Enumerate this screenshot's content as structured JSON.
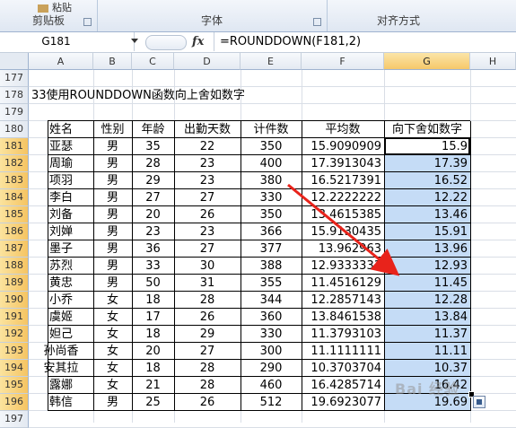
{
  "ribbon": {
    "paste_label": "粘贴",
    "groups": [
      {
        "label": "剪贴板"
      },
      {
        "label": "字体"
      },
      {
        "label": "对齐方式"
      }
    ]
  },
  "formula_bar": {
    "name_box": "G181",
    "fx": "fx",
    "formula": "=ROUNDDOWN(F181,2)"
  },
  "columns": [
    "A",
    "B",
    "C",
    "D",
    "E",
    "F",
    "G",
    "H"
  ],
  "selected_column": "G",
  "title_row": {
    "row": "178",
    "text": "33使用ROUNDDOWN函数向上舍如数字"
  },
  "header_row": {
    "row": "180",
    "cells": [
      "姓名",
      "性别",
      "年龄",
      "出勤天数",
      "计件数",
      "平均数",
      "向下舍如数字"
    ]
  },
  "rows_top": [
    "177",
    "178",
    "179"
  ],
  "data_rows": [
    {
      "row": "181",
      "name": "亚瑟",
      "gender": "男",
      "age": "35",
      "days": "22",
      "pieces": "350",
      "avg": "15.9090909",
      "round": "15.9"
    },
    {
      "row": "182",
      "name": "周瑜",
      "gender": "男",
      "age": "28",
      "days": "23",
      "pieces": "400",
      "avg": "17.3913043",
      "round": "17.39"
    },
    {
      "row": "183",
      "name": "项羽",
      "gender": "男",
      "age": "29",
      "days": "23",
      "pieces": "380",
      "avg": "16.5217391",
      "round": "16.52"
    },
    {
      "row": "184",
      "name": "李白",
      "gender": "男",
      "age": "27",
      "days": "27",
      "pieces": "330",
      "avg": "12.2222222",
      "round": "12.22"
    },
    {
      "row": "185",
      "name": "刘备",
      "gender": "男",
      "age": "20",
      "days": "26",
      "pieces": "350",
      "avg": "13.4615385",
      "round": "13.46"
    },
    {
      "row": "186",
      "name": "刘婵",
      "gender": "男",
      "age": "23",
      "days": "23",
      "pieces": "366",
      "avg": "15.9130435",
      "round": "15.91"
    },
    {
      "row": "187",
      "name": "墨子",
      "gender": "男",
      "age": "36",
      "days": "27",
      "pieces": "377",
      "avg": "13.962963",
      "round": "13.96"
    },
    {
      "row": "188",
      "name": "苏烈",
      "gender": "男",
      "age": "33",
      "days": "30",
      "pieces": "388",
      "avg": "12.9333333",
      "round": "12.93"
    },
    {
      "row": "189",
      "name": "黄忠",
      "gender": "男",
      "age": "50",
      "days": "31",
      "pieces": "355",
      "avg": "11.4516129",
      "round": "11.45"
    },
    {
      "row": "190",
      "name": "小乔",
      "gender": "女",
      "age": "18",
      "days": "28",
      "pieces": "344",
      "avg": "12.2857143",
      "round": "12.28"
    },
    {
      "row": "191",
      "name": "虞姬",
      "gender": "女",
      "age": "17",
      "days": "26",
      "pieces": "360",
      "avg": "13.8461538",
      "round": "13.84"
    },
    {
      "row": "192",
      "name": "妲己",
      "gender": "女",
      "age": "18",
      "days": "29",
      "pieces": "330",
      "avg": "11.3793103",
      "round": "11.37"
    },
    {
      "row": "193",
      "name": "孙尚香",
      "gender": "女",
      "age": "20",
      "days": "27",
      "pieces": "300",
      "avg": "11.1111111",
      "round": "11.11"
    },
    {
      "row": "194",
      "name": "安其拉",
      "gender": "女",
      "age": "18",
      "days": "28",
      "pieces": "290",
      "avg": "10.3703704",
      "round": "10.37"
    },
    {
      "row": "195",
      "name": "露娜",
      "gender": "女",
      "age": "21",
      "days": "28",
      "pieces": "460",
      "avg": "16.4285714",
      "round": "16.42"
    },
    {
      "row": "196",
      "name": "韩信",
      "gender": "男",
      "age": "25",
      "days": "26",
      "pieces": "512",
      "avg": "19.6923077",
      "round": "19.69"
    }
  ],
  "rows_bottom": [
    "197"
  ],
  "colors": {
    "selection": "#c5dcf6",
    "header_selected": "#f6c86a",
    "arrow": "#e8231b"
  }
}
